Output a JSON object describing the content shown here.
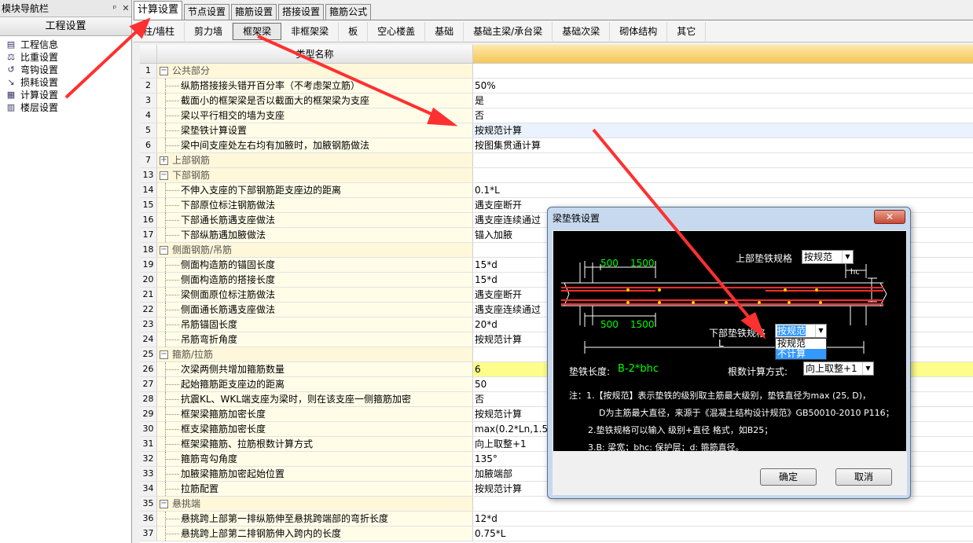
{
  "nav": {
    "title": "模块导航栏",
    "pin": "ᵖ",
    "close": "✕",
    "section": "工程设置",
    "items": [
      {
        "label": "工程信息",
        "icon": "project-info-icon"
      },
      {
        "label": "比重设置",
        "icon": "density-icon"
      },
      {
        "label": "弯钩设置",
        "icon": "hook-icon"
      },
      {
        "label": "损耗设置",
        "icon": "loss-icon"
      },
      {
        "label": "计算设置",
        "icon": "calc-icon"
      },
      {
        "label": "楼层设置",
        "icon": "floor-icon"
      }
    ]
  },
  "tabs": [
    "计算设置",
    "节点设置",
    "箍筋设置",
    "搭接设置",
    "箍筋公式"
  ],
  "subtabs": [
    "柱/墙柱",
    "剪力墙",
    "框架梁",
    "非框架梁",
    "板",
    "空心楼盖",
    "基础",
    "基础主梁/承台梁",
    "基础次梁",
    "砌体结构",
    "其它"
  ],
  "grid": {
    "header_name": "类型名称",
    "rows": [
      {
        "num": "1",
        "group": true,
        "expander": "−",
        "name": "公共部分",
        "value": ""
      },
      {
        "num": "2",
        "name": "纵筋搭接接头错开百分率（不考虑架立筋）",
        "value": "50%"
      },
      {
        "num": "3",
        "name": "截面小的框架梁是否以截面大的框架梁为支座",
        "value": "是"
      },
      {
        "num": "4",
        "name": "梁以平行相交的墙为支座",
        "value": "否"
      },
      {
        "num": "5",
        "name": "梁垫铁计算设置",
        "value": "按规范计算",
        "state": "selected"
      },
      {
        "num": "6",
        "name": "梁中间支座处左右均有加腋时，加腋钢筋做法",
        "value": "按图集贯通计算"
      },
      {
        "num": "7",
        "group": true,
        "expander": "+",
        "name": "上部钢筋",
        "value": ""
      },
      {
        "num": "13",
        "group": true,
        "expander": "−",
        "name": "下部钢筋",
        "value": ""
      },
      {
        "num": "14",
        "name": "不伸入支座的下部钢筋距支座边的距离",
        "value": "0.1*L"
      },
      {
        "num": "15",
        "name": "下部原位标注钢筋做法",
        "value": "遇支座断开"
      },
      {
        "num": "16",
        "name": "下部通长筋遇支座做法",
        "value": "遇支座连续通过"
      },
      {
        "num": "17",
        "name": "下部纵筋遇加腋做法",
        "value": "锚入加腋"
      },
      {
        "num": "18",
        "group": true,
        "expander": "−",
        "name": "侧面钢筋/吊筋",
        "value": ""
      },
      {
        "num": "19",
        "name": "侧面构造筋的锚固长度",
        "value": "15*d"
      },
      {
        "num": "20",
        "name": "侧面构造筋的搭接长度",
        "value": "15*d"
      },
      {
        "num": "21",
        "name": "梁侧面原位标注筋做法",
        "value": "遇支座断开"
      },
      {
        "num": "22",
        "name": "侧面通长筋遇支座做法",
        "value": "遇支座连续通过"
      },
      {
        "num": "23",
        "name": "吊筋锚固长度",
        "value": "20*d"
      },
      {
        "num": "24",
        "name": "吊筋弯折角度",
        "value": "按规范计算"
      },
      {
        "num": "25",
        "group": true,
        "expander": "−",
        "name": "箍筋/拉筋",
        "value": ""
      },
      {
        "num": "26",
        "name": "次梁两侧共增加箍筋数量",
        "value": "6",
        "state": "highlight"
      },
      {
        "num": "27",
        "name": "起始箍筋距支座边的距离",
        "value": "50"
      },
      {
        "num": "28",
        "name": "抗震KL、WKL端支座为梁时，则在该支座一侧箍筋加密",
        "value": "否"
      },
      {
        "num": "29",
        "name": "框架梁箍筋加密长度",
        "value": "按规范计算"
      },
      {
        "num": "30",
        "name": "框支梁箍筋加密长度",
        "value": "max(0.2*Ln,1.5*"
      },
      {
        "num": "31",
        "name": "框架梁箍筋、拉筋根数计算方式",
        "value": "向上取整+1"
      },
      {
        "num": "32",
        "name": "箍筋弯勾角度",
        "value": "135°"
      },
      {
        "num": "33",
        "name": "加腋梁箍筋加密起始位置",
        "value": "加腋端部"
      },
      {
        "num": "34",
        "name": "拉筋配置",
        "value": "按规范计算"
      },
      {
        "num": "35",
        "group": true,
        "expander": "−",
        "name": "悬挑端",
        "value": ""
      },
      {
        "num": "36",
        "name": "悬挑跨上部第一排纵筋伸至悬挑跨端部的弯折长度",
        "value": "12*d"
      },
      {
        "num": "37",
        "name": "悬挑跨上部第二排钢筋伸入跨内的长度",
        "value": "0.75*L"
      }
    ]
  },
  "dialog": {
    "title": "梁垫铁设置",
    "close": "✕",
    "dim_500_top": "500",
    "dim_1500_top": "1500",
    "dim_500_bottom": "500",
    "dim_1500_bottom": "1500",
    "hc": "hc",
    "h": "h",
    "L": "L",
    "upper_label": "上部垫铁规格",
    "upper_value": "按规范",
    "lower_label": "下部垫铁规格",
    "lower_value": "按规范",
    "lower_options": [
      "按规范",
      "不计算"
    ],
    "length_label": "垫铁长度:",
    "length_value": "B-2*bhc",
    "count_label": "根数计算方式:",
    "count_value": "向上取整+1",
    "notes": [
      "注：1.【按规范】表示垫铁的级别取主筋最大级别，垫铁直径为max (25, D)，",
      "D为主筋最大直径，来源于《混凝土结构设计规范》GB50010-2010 P116；",
      "2.垫铁规格可以输入 级别+直径 格式，如B25；",
      "3.B: 梁宽；bhc: 保护层；d: 箍筋直径。"
    ],
    "ok": "确定",
    "cancel": "取消"
  }
}
